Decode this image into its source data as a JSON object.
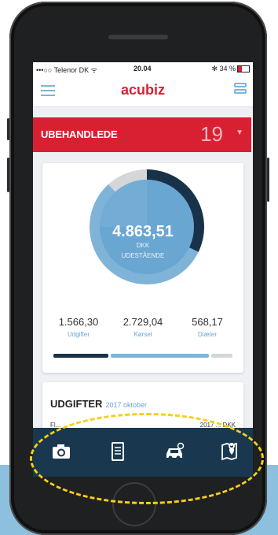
{
  "status": {
    "carrier": "•••○○ Telenor DK ᯤ",
    "time": "20.04",
    "battery": "✻ 34 %"
  },
  "app": {
    "brand": "acubiz"
  },
  "unprocessed": {
    "label": "UBEHANDLEDE",
    "count": "19"
  },
  "summary": {
    "amount": "4.863,51",
    "currency": "DKK",
    "caption": "UDESTÅENDE",
    "stats": [
      {
        "value": "1.566,30",
        "label": "Udgifter"
      },
      {
        "value": "2.729,04",
        "label": "Kørsel"
      },
      {
        "value": "568,17",
        "label": "Diæter"
      }
    ],
    "shares": [
      0.322,
      0.561,
      0.117
    ],
    "colors": {
      "expenses": "#18324a",
      "mileage": "#7fb4d8",
      "allowance": "#d5d6d8"
    }
  },
  "expenses": {
    "title": "UDGIFTER",
    "period": "2017 oktober",
    "row_left": "Fl...",
    "row_right": "2017 ... DKK"
  },
  "tabbar": {
    "icons": [
      "camera-icon",
      "receipt-icon",
      "car-icon",
      "map-pin-icon"
    ]
  }
}
